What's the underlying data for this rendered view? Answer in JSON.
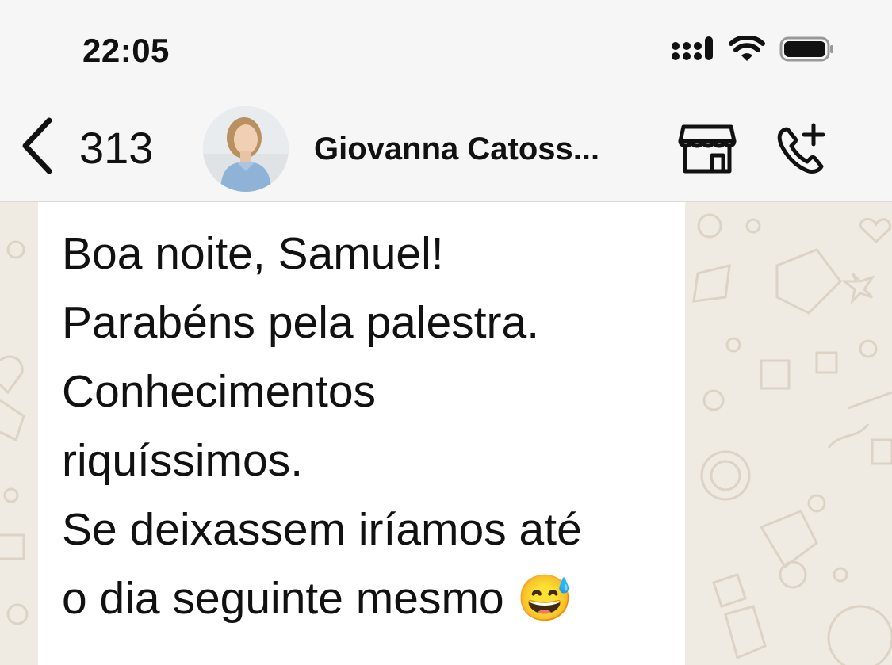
{
  "status_bar": {
    "time": "22:05"
  },
  "header": {
    "back_count": "313",
    "contact_name": "Giovanna Catoss...",
    "store_icon": "storefront-icon",
    "call_icon": "add-call-icon"
  },
  "message": {
    "text": "Boa noite, Samuel!\nParabéns pela palestra.\nConhecimentos\nriquíssimos.\nSe deixassem iríamos até\no dia seguinte mesmo 😅"
  },
  "colors": {
    "header_bg": "#f6f6f6",
    "chat_bg": "#efeae2",
    "bubble_bg": "#ffffff",
    "text": "#111111"
  }
}
